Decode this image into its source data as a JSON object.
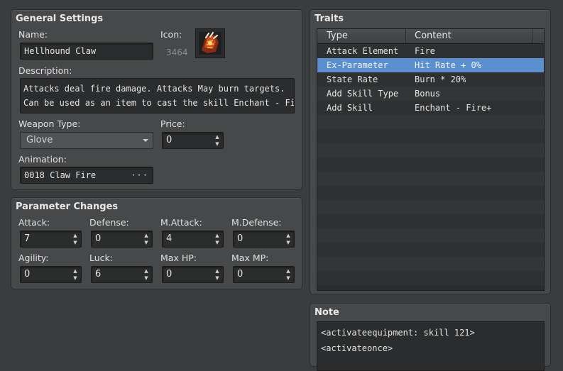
{
  "general": {
    "title": "General Settings",
    "name_label": "Name:",
    "name_value": "Hellhound Claw",
    "icon_label": "Icon:",
    "icon_index": "3464",
    "description_label": "Description:",
    "description_lines": [
      "Attacks deal fire damage. Attacks May burn targets.",
      "Can be used as an item to cast the skill Enchant - Fire+"
    ],
    "weapon_type_label": "Weapon Type:",
    "weapon_type_value": "Glove",
    "price_label": "Price:",
    "price_value": "0",
    "animation_label": "Animation:",
    "animation_value": "0018 Claw Fire",
    "animation_button": "···"
  },
  "params": {
    "title": "Parameter Changes",
    "fields": [
      {
        "label": "Attack:",
        "value": "7"
      },
      {
        "label": "Defense:",
        "value": "0"
      },
      {
        "label": "M.Attack:",
        "value": "4"
      },
      {
        "label": "M.Defense:",
        "value": "0"
      },
      {
        "label": "Agility:",
        "value": "0"
      },
      {
        "label": "Luck:",
        "value": "6"
      },
      {
        "label": "Max HP:",
        "value": "0"
      },
      {
        "label": "Max MP:",
        "value": "0"
      }
    ]
  },
  "traits": {
    "title": "Traits",
    "columns": [
      "Type",
      "Content"
    ],
    "rows": [
      {
        "type": "Attack Element",
        "content": "Fire"
      },
      {
        "type": "Ex-Parameter",
        "content": "Hit Rate + 0%"
      },
      {
        "type": "State Rate",
        "content": "Burn * 20%"
      },
      {
        "type": "Add Skill Type",
        "content": "Bonus"
      },
      {
        "type": "Add Skill",
        "content": "Enchant - Fire+"
      }
    ],
    "selected_index": 1
  },
  "note": {
    "title": "Note",
    "lines": [
      "<activateequipment: skill 121>",
      "<activateonce>"
    ]
  },
  "colors": {
    "selection": "#5a8fd0",
    "panel": "#46484a",
    "field": "#2b2c2d"
  }
}
